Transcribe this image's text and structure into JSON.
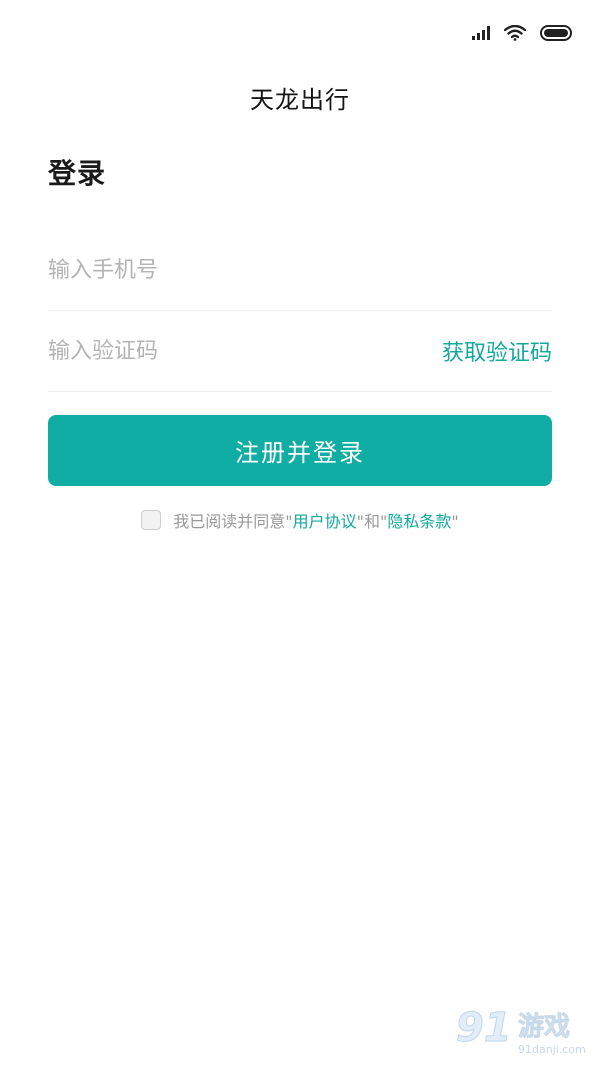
{
  "status_bar": {
    "icons": [
      "signal-icon",
      "wifi-icon",
      "battery-icon"
    ]
  },
  "header": {
    "app_title": "天龙出行"
  },
  "login": {
    "page_title": "登录",
    "phone_placeholder": "输入手机号",
    "code_placeholder": "输入验证码",
    "get_code_label": "获取验证码",
    "submit_label": "注册并登录"
  },
  "agreement": {
    "checked": false,
    "prefix": "我已阅读并同意\"",
    "user_agreement": "用户协议",
    "middle": "\"和\"",
    "privacy_policy": "隐私条款",
    "suffix": "\""
  },
  "watermark": {
    "logo_text": "91游戏",
    "site_text": "91danji.com"
  },
  "colors": {
    "accent": "#0fada3",
    "link": "#11a89d",
    "placeholder": "#b4b4b4",
    "divider": "#eeeeee"
  }
}
